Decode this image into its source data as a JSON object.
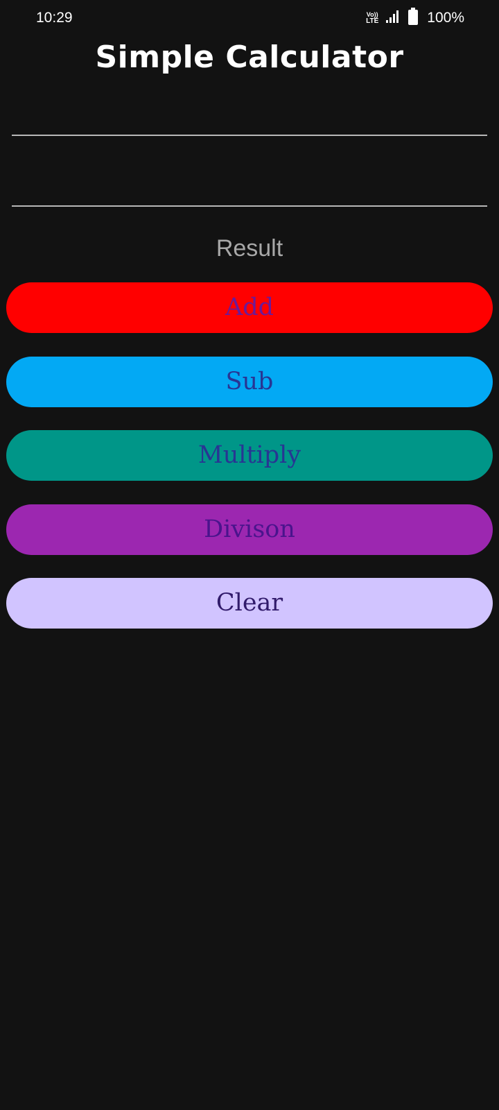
{
  "status_bar": {
    "time": "10:29",
    "volte_top": "Vo))",
    "volte_bottom": "LTE",
    "battery": "100%"
  },
  "app": {
    "title": "Simple Calculator"
  },
  "inputs": {
    "first_value": "",
    "second_value": ""
  },
  "result": {
    "label": "Result"
  },
  "buttons": {
    "add": "Add",
    "sub": "Sub",
    "multiply": "Multiply",
    "division": "Divison",
    "clear": "Clear"
  },
  "colors": {
    "background": "#121212",
    "add": "#ff0000",
    "sub": "#03a9f4",
    "multiply": "#009688",
    "division": "#9c27b0",
    "clear": "#d1c4ff"
  }
}
